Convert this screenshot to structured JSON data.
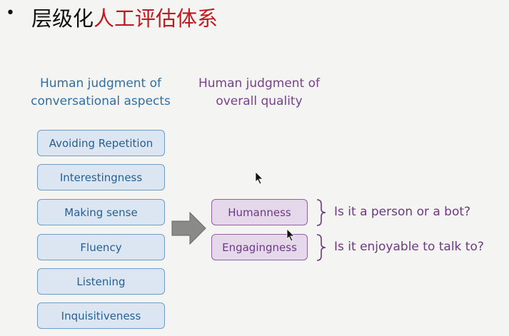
{
  "title": {
    "bullet": "•",
    "prefix": "层级化",
    "highlight": "人工评估体系"
  },
  "left_column": {
    "heading_line1": "Human judgment of",
    "heading_line2": "conversational aspects",
    "items": [
      "Avoiding Repetition",
      "Interestingness",
      "Making sense",
      "Fluency",
      "Listening",
      "Inquisitiveness"
    ]
  },
  "right_column": {
    "heading_line1": "Human judgment of",
    "heading_line2": "overall quality",
    "items": [
      {
        "label": "Humanness",
        "question": "Is it a person or a bot?"
      },
      {
        "label": "Engagingness",
        "question": "Is it enjoyable to talk to?"
      }
    ]
  },
  "colors": {
    "highlight": "#c0191f",
    "aspect_text": "#275f92",
    "aspect_fill": "#dbe6f2",
    "quality_text": "#6d3a82",
    "quality_fill": "#e5d8ea",
    "arrow": "#8a8a8a"
  }
}
